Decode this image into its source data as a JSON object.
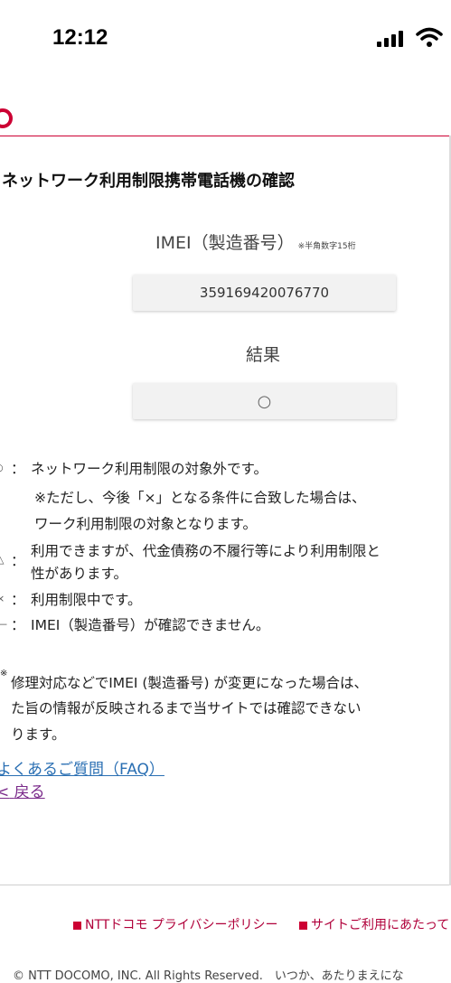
{
  "status_bar": {
    "time": "12:12"
  },
  "page": {
    "title": "ネットワーク利用制限携帯電話機の確認",
    "imei_label": "IMEI（製造番号）",
    "imei_note": "※半角数字15桁",
    "imei_value": "359169420076770",
    "result_label": "結果",
    "result_value": "○"
  },
  "legend": [
    {
      "symbol": "○",
      "sep": "：",
      "line1": "ネットワーク利用制限の対象外です。"
    },
    {
      "line2": "※ただし、今後「×」となる条件に合致した場合は、",
      "line3": "ワーク利用制限の対象となります。"
    },
    {
      "symbol": "△",
      "sep": "：",
      "line1": "利用できますが、代金債務の不履行等により利用制限と",
      "line2": "性があります。"
    },
    {
      "symbol": "×",
      "sep": "：",
      "line1": "利用制限中です。"
    },
    {
      "symbol": "－",
      "sep": "：",
      "line1": "IMEI（製造番号）が確認できません。"
    }
  ],
  "note": {
    "mark": "※",
    "line1": "修理対応などでIMEI (製造番号) が変更になった場合は、",
    "line2": "た旨の情報が反映されるまで当サイトでは確認できない",
    "line3": "ります。"
  },
  "links": {
    "faq": "よくあるご質問（FAQ）",
    "back": "戻る"
  },
  "footer": {
    "privacy": "NTTドコモ プライバシーポリシー",
    "terms": "サイトご利用にあたって",
    "copyright": "© NTT DOCOMO, INC. All Rights Reserved.　いつか、あたりまえにな"
  }
}
